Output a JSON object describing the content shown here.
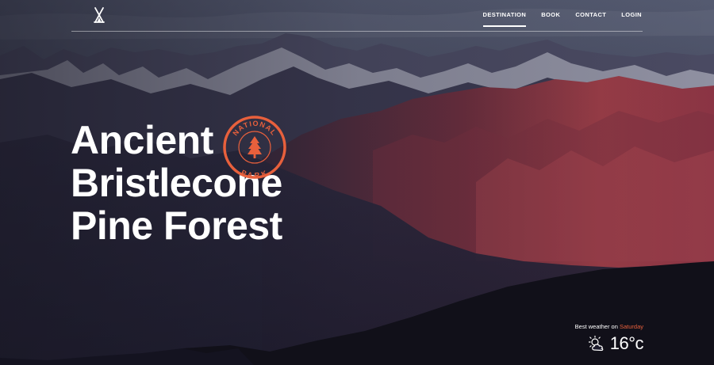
{
  "nav": {
    "links": [
      "DESTINATION",
      "BOOK",
      "CONTACT",
      "LOGIN"
    ],
    "active_index": 0
  },
  "hero": {
    "title_lines": [
      "Ancient",
      "Bristlecone",
      "Pine Forest"
    ],
    "badge": {
      "top_text": "NATIONAL",
      "bottom_text": "PARK",
      "icon": "pine-tree-icon",
      "color": "#e8603c"
    }
  },
  "weather": {
    "label": "Best weather on",
    "day": "Saturday",
    "temperature": "16°c",
    "icon": "sun-cloud-icon",
    "accent": "#e8603c"
  },
  "colors": {
    "sky": "#3b3f56",
    "mountain_red": "#8a3a44",
    "foreground": "#111019",
    "text": "#ffffff"
  }
}
